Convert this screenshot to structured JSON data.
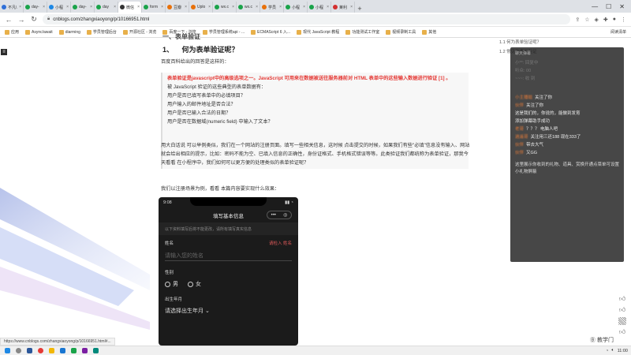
{
  "tabs": [
    {
      "label": "不凡\\",
      "color": "#2f6fd8"
    },
    {
      "label": "day-",
      "color": "#1aa34a"
    },
    {
      "label": "小程",
      "color": "#1e88e5"
    },
    {
      "label": "day-",
      "color": "#1aa34a"
    },
    {
      "label": "day",
      "color": "#1aa34a"
    },
    {
      "label": "微信",
      "color": "#333333",
      "active": true
    },
    {
      "label": "form",
      "color": "#1aa34a"
    },
    {
      "label": "豆瓣",
      "color": "#e8710a"
    },
    {
      "label": "Uplo",
      "color": "#e8710a"
    },
    {
      "label": "wx.c",
      "color": "#1aa34a"
    },
    {
      "label": "wx.c",
      "color": "#1aa34a"
    },
    {
      "label": "学员",
      "color": "#e8710a"
    },
    {
      "label": "小程",
      "color": "#1aa34a"
    },
    {
      "label": "小程",
      "color": "#1aa34a"
    },
    {
      "label": "莱利",
      "color": "#d32f2f"
    }
  ],
  "toolbar": {
    "url": "cnblogs.com/zhangxiaoyong/p/10166951.html"
  },
  "bookmarks": [
    "应用",
    "Async/await",
    "diarming",
    "学员管理后台",
    "开源社区 - 浏览",
    "百度一下 - 浏览",
    "学员管理系统api - ...",
    "ECMAScript 6 入...",
    "现代 JavaScript 教程",
    "功能测试工作室",
    "视频录制工具",
    "其他"
  ],
  "bookmarks_right": "阅读清单",
  "article": {
    "partial_top": "一、表单验证",
    "heading_num": "1、",
    "heading": "何为表单验证呢？",
    "intro": "百度百科给出的回答是这样的：",
    "quote_red": "表单验证是javascript中的高级选项之一。JavaScript 可用来在数据被送往服务器前对 HTML 表单中的这些输入数据进行验证 [1] 。",
    "quote_lines": [
      "被 JavaScript 验证的这些典型的表单数据有：",
      "用户是否已填写表单中的必填项目？",
      "用户输入的邮件地址是否合法？",
      "用户是否已输入合法的日期？",
      "用户是否在数据域(numeric field) 中输入了文本？"
    ],
    "plain_1": "用大白话说 可以举例类似，我们在一个网站的注册页面。填写一些相关信息，这时候 点击提交的时候，如果我们有些\"必填\"信息没有输入、网站就会给出相应的提示，比如：密码不能为空、已填入信息的正确性，身份证格式、手机格式错误等等。此类验证我们都统称为表单验证，那我今天看看 在小程序中，我们如何可以更方便的处理类似的表单验证呢？",
    "plain_2": "我们以注册场景为例，看看 本篇内容要实现什么效果："
  },
  "phone": {
    "time": "9:08",
    "title": "填写基本信息",
    "caps": "•••",
    "tip": "以下资料填写后将不能更改，请所有填写真实信息",
    "name_label": "姓名",
    "name_req": "请检入 姓名",
    "name_placeholder": "请输入您的姓名",
    "gender_label": "性别",
    "male": "男",
    "female": "女",
    "birth_label": "出生年月",
    "birth_value": "请选择出生年月 ⌄"
  },
  "toc": [
    "1.1  何为表单验证呢？",
    "1.2  常见的表单验证"
  ],
  "live": {
    "head": "聊天弹幕",
    "faint_lines": [
      "小**: 回复中",
      "听众: 00",
      "~~~: 收 到"
    ],
    "chat": [
      {
        "user": "小主播姐",
        "text": "关注了你"
      },
      {
        "user": "伙伴",
        "text": "关注了你"
      },
      {
        "user": "",
        "text": "这是我们的，你说的，能做到发育"
      },
      {
        "user": "",
        "text": "添加弹幕助手成功"
      },
      {
        "user": "老哥",
        "text": "？？？ 电脑人吧"
      },
      {
        "user": "逍遥哥",
        "text": "关注用三还188 现在333了"
      },
      {
        "user": "伙伴",
        "text": "带去大气"
      },
      {
        "user": "伙伴",
        "text": "又GG"
      }
    ],
    "note": "这里展示你收到的礼物、道具、赏换开通点菜单可设置小礼物屏蔽"
  },
  "status_url": "https://www.cnblogs.com/zhangxiaoyong/p/10166951.html#...",
  "watermark": "Ⓑ 教学门",
  "clock": "11:00",
  "colors": {
    "quote_red": "#e53935",
    "link_blue": "#1e88e5",
    "phone_bg": "#1b1b1b",
    "overlay_bg": "#1e1e1e"
  }
}
